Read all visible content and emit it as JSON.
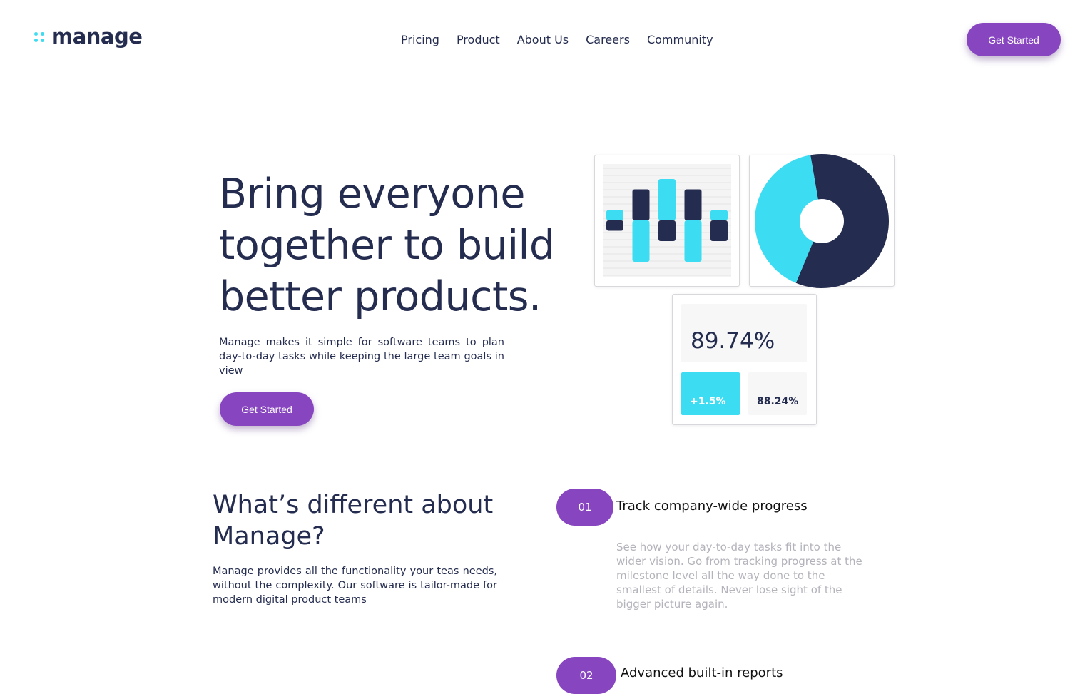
{
  "header": {
    "logo_text": "manage",
    "nav": [
      "Pricing",
      "Product",
      "About Us",
      "Careers",
      "Community"
    ],
    "cta_label": "Get Started"
  },
  "hero": {
    "title": "Bring everyone together to build better products.",
    "description": "Manage makes it simple for software teams to plan day-to-day tasks while keeping the large team goals in view",
    "cta_label": "Get Started"
  },
  "stats": {
    "main_value": "89.74%",
    "change_value": "+1.5%",
    "secondary_value": "88.24%"
  },
  "differences": {
    "title": "What’s different about Manage?",
    "description": "Manage provides all the functionality your teas needs, without the complexity. Our software is tailor-made for modern digital product teams"
  },
  "features": [
    {
      "number": "01",
      "title": "Track company-wide progress",
      "description": "See how your day-to-day tasks fit into the wider vision. Go from tracking progress at the milestone level all the way done to the smallest of details. Never lose sight of the bigger picture again."
    },
    {
      "number": "02",
      "title": "Advanced built-in reports"
    }
  ],
  "colors": {
    "accent": "#8745c0",
    "navy": "#242c4f",
    "cyan": "#3cdcf2"
  },
  "chart_data": [
    {
      "type": "bar",
      "categories": [
        "1",
        "2",
        "3",
        "4",
        "5"
      ],
      "series": [
        {
          "values": [
            1,
            3,
            4,
            3,
            1
          ]
        },
        {
          "values": [
            1,
            -4,
            -2,
            -4,
            -2
          ]
        }
      ]
    },
    {
      "type": "pie",
      "values": [
        59,
        41
      ]
    }
  ]
}
